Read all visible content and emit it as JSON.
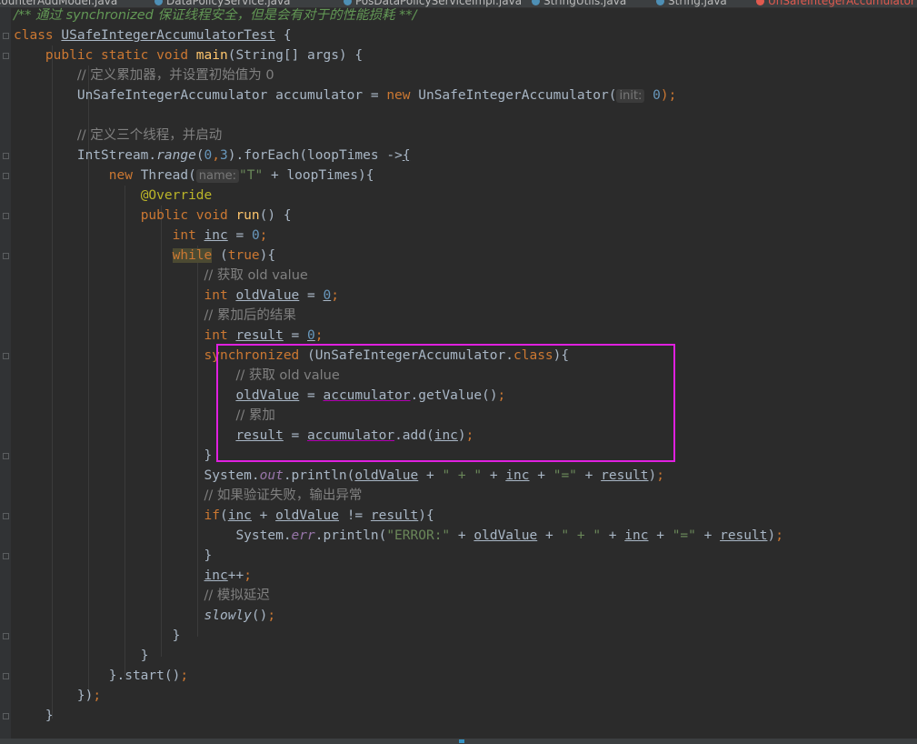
{
  "tabs": [
    {
      "label": "CounterAddModel.java",
      "active": false
    },
    {
      "label": "DataPolicyService.java",
      "active": false
    },
    {
      "label": "PosDataPolicyServiceImpl.java",
      "active": false
    },
    {
      "label": "StringUtils.java",
      "active": false
    },
    {
      "label": "String.java",
      "active": false
    },
    {
      "label": "UnSafeIntegerAccumulatorTest",
      "active": true
    }
  ],
  "code": {
    "l0_doc": "/** 通过 synchronized 保证线程安全，但是会有对于的性能损耗 **/",
    "l1_kw": "class ",
    "l1_name": "USafeIntegerAccumulatorTest",
    "l1_rest": " {",
    "l2_kw": "public static void ",
    "l2_fn": "main",
    "l2_rest": "(String[] args) {",
    "l3_cmt": "// 定义累加器，并设置初始值为 0",
    "l4_a": "UnSafeIntegerAccumulator accumulator = ",
    "l4_new": "new ",
    "l4_b": "UnSafeIntegerAccumulator(",
    "l4_hint": "init:",
    "l4_num": "0",
    "l4_c": ");",
    "l6_cmt": "// 定义三个线程，并启动",
    "l7_a": "IntStream.",
    "l7_range": "range",
    "l7_b": "(",
    "l7_n0": "0",
    "l7_comma": ",",
    "l7_n3": "3",
    "l7_c": ").forEach(loopTimes ->",
    "l7_brace": "{",
    "l8_new": "new ",
    "l8_a": "Thread(",
    "l8_hint": "name:",
    "l8_str": "\"T\"",
    "l8_b": " + loopTimes){",
    "l9_ann": "@Override",
    "l10_kw": "public void ",
    "l10_fn": "run",
    "l10_rest": "() {",
    "l11_kw": "int ",
    "l11_var": "inc",
    "l11_a": " = ",
    "l11_num": "0",
    "l11_semi": ";",
    "l12_kw": "while",
    "l12_a": " (",
    "l12_true": "true",
    "l12_b": "){",
    "l13_cmt": "// 获取 old value",
    "l14_kw": "int ",
    "l14_var": "oldValue",
    "l14_a": " = ",
    "l14_num": "0",
    "l14_semi": ";",
    "l15_cmt": "// 累加后的结果",
    "l16_kw": "int ",
    "l16_var": "result",
    "l16_a": " = ",
    "l16_num": "0",
    "l16_semi": ";",
    "l17_kw": "synchronized ",
    "l17_a": "(UnSafeIntegerAccumulator.",
    "l17_class": "class",
    "l17_b": "){",
    "l18_cmt": "// 获取 old value",
    "l19_var": "oldValue",
    "l19_a": " = ",
    "l19_acc": "accumulator",
    "l19_b": ".getValue()",
    "l19_semi": ";",
    "l20_cmt": "// 累加",
    "l21_var": "result",
    "l21_a": " = ",
    "l21_acc": "accumulator",
    "l21_b": ".add(",
    "l21_inc": "inc",
    "l21_c": ")",
    "l21_semi": ";",
    "l22": "}",
    "l23_a": "System.",
    "l23_out": "out",
    "l23_b": ".println(",
    "l23_old": "oldValue",
    "l23_c": " + ",
    "l23_s1": "\" + \"",
    "l23_d": " + ",
    "l23_inc": "inc",
    "l23_e": " + ",
    "l23_s2": "\"=\"",
    "l23_f": " + ",
    "l23_res": "result",
    "l23_g": ")",
    "l23_semi": ";",
    "l24_cmt": "// 如果验证失败，输出异常",
    "l25_kw": "if",
    "l25_a": "(",
    "l25_inc": "inc",
    "l25_b": " + ",
    "l25_old": "oldValue",
    "l25_c": " != ",
    "l25_res": "result",
    "l25_d": "){",
    "l26_a": "System.",
    "l26_err": "err",
    "l26_b": ".println(",
    "l26_s1": "\"ERROR:\"",
    "l26_c": " + ",
    "l26_old": "oldValue",
    "l26_d": " + ",
    "l26_s2": "\" + \"",
    "l26_e": " + ",
    "l26_inc": "inc",
    "l26_f": " + ",
    "l26_s3": "\"=\"",
    "l26_g": " + ",
    "l26_res": "result",
    "l26_h": ")",
    "l26_semi": ";",
    "l27": "}",
    "l28_inc": "inc",
    "l28_a": "++",
    "l28_semi": ";",
    "l29_cmt": "// 模拟延迟",
    "l30_fn": "slowly",
    "l30_a": "()",
    "l30_semi": ";",
    "l31": "}",
    "l32": "}",
    "l33_a": "}.start()",
    "l33_semi": ";",
    "l34_a": "})",
    "l34_semi": ";",
    "l35": "}"
  },
  "colors": {
    "background": "#2b2b2b",
    "keyword": "#cc7832",
    "function": "#ffc66d",
    "number": "#6897bb",
    "string": "#6a8759",
    "comment": "#808080",
    "highlight_box": "#e020e0"
  }
}
